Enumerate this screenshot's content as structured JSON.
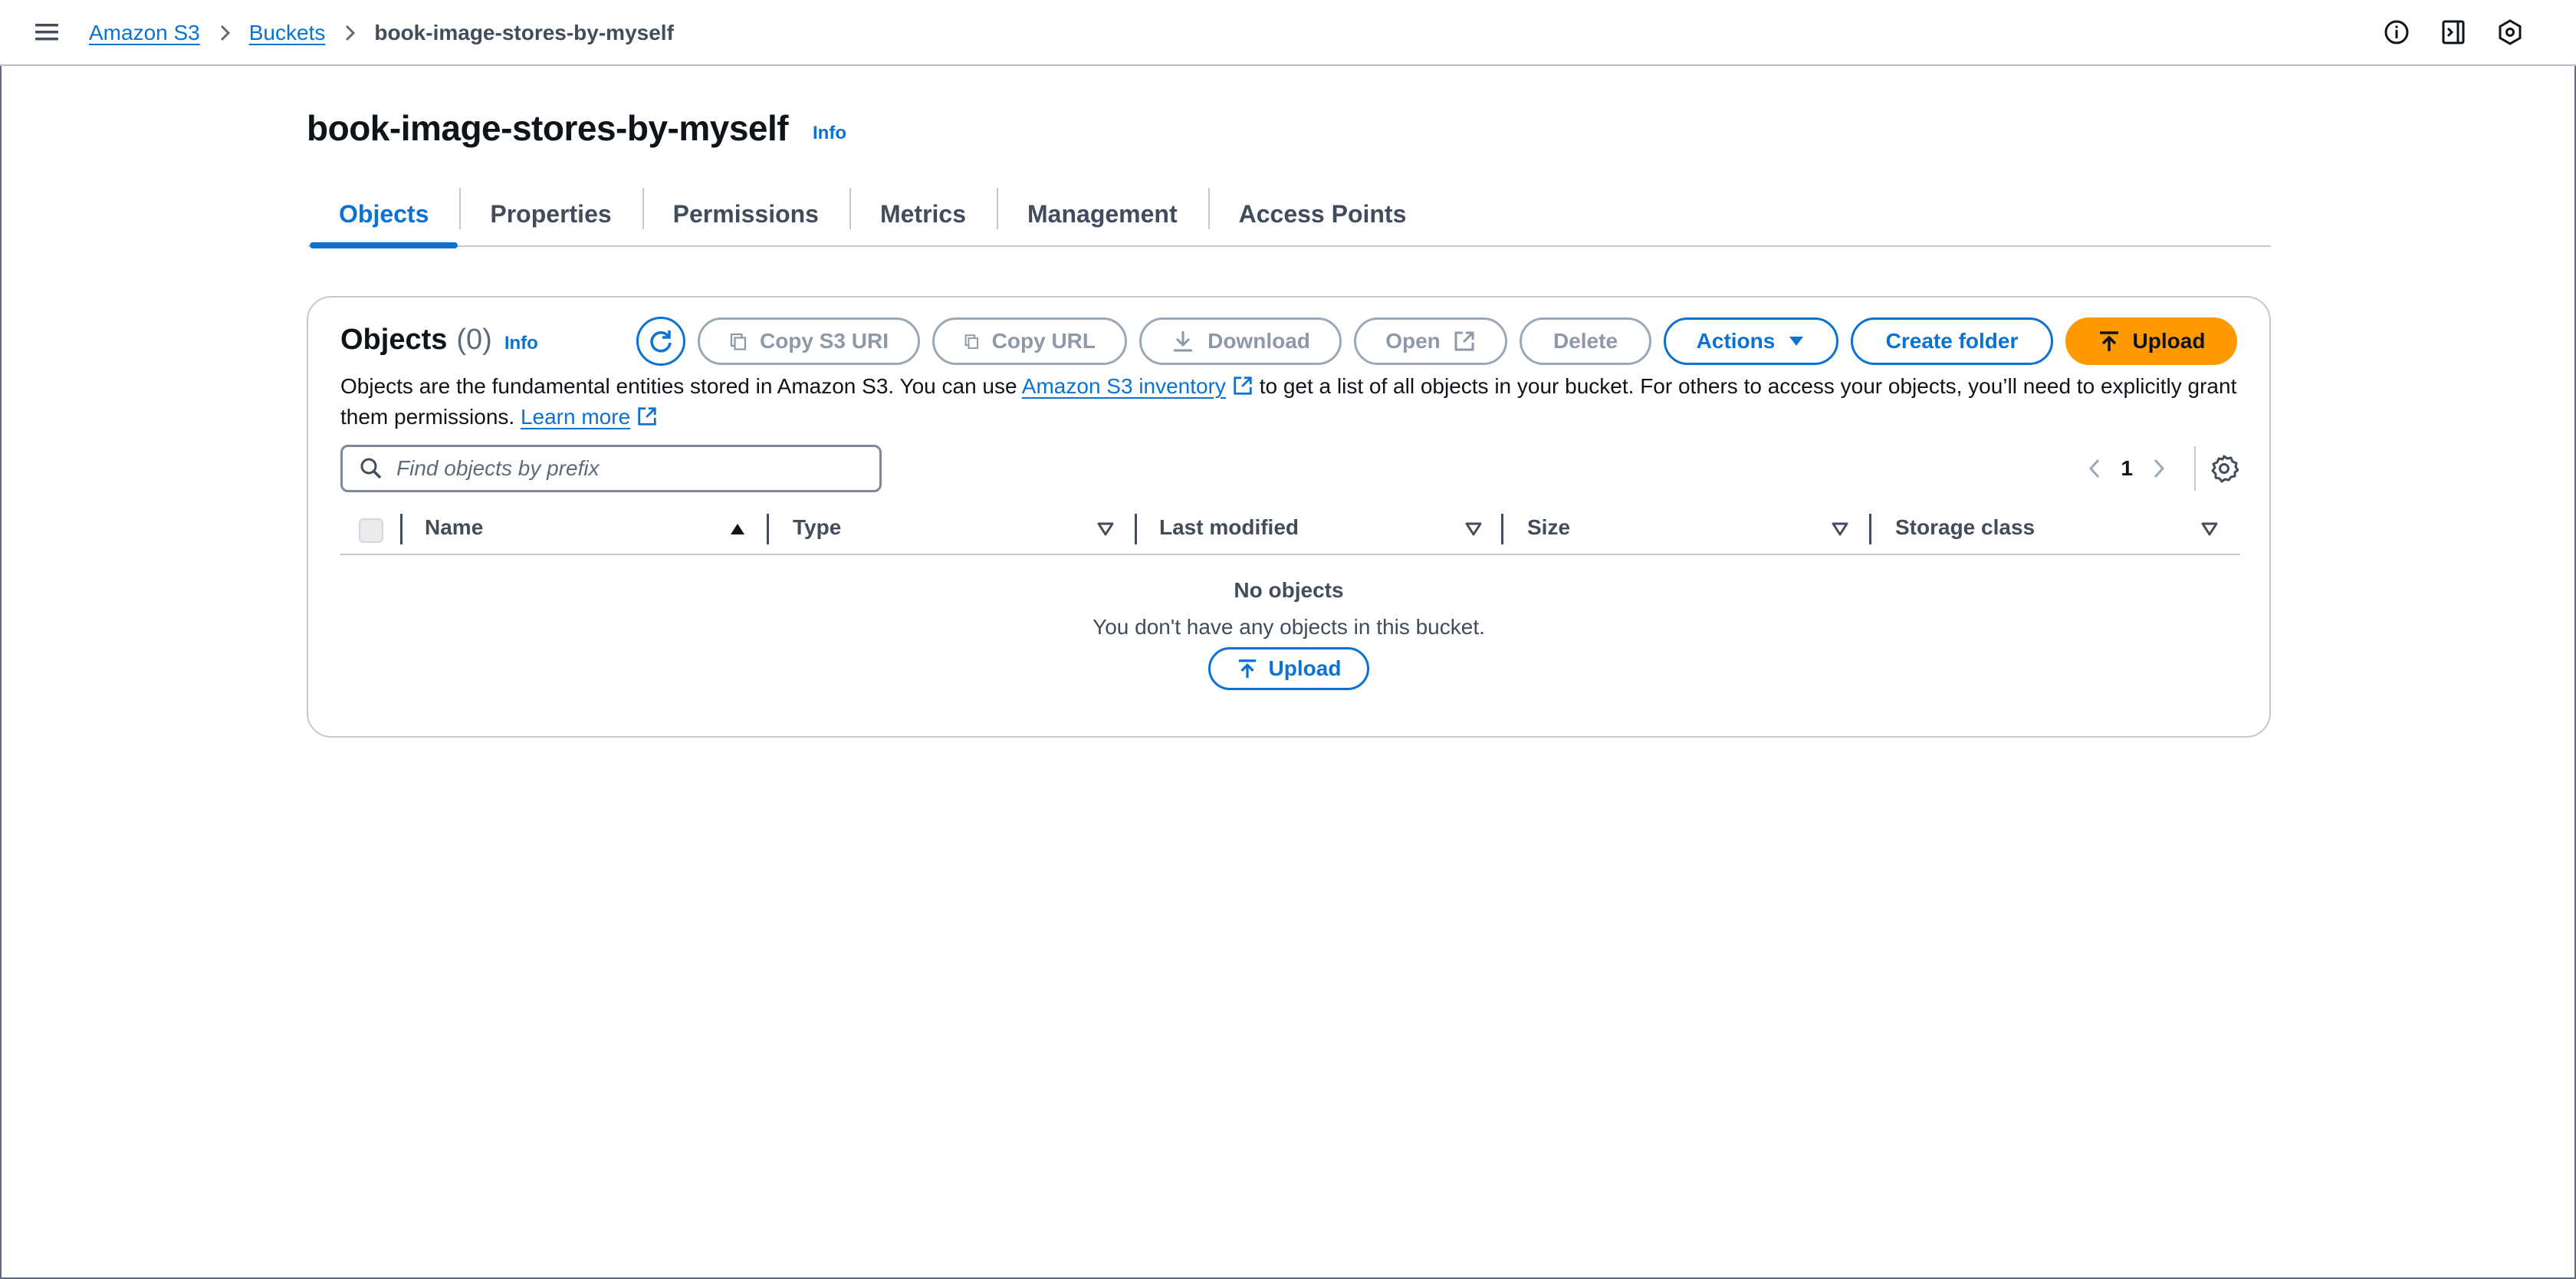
{
  "breadcrumb": {
    "items": [
      {
        "label": "Amazon S3",
        "link": true
      },
      {
        "label": "Buckets",
        "link": true
      },
      {
        "label": "book-image-stores-by-myself",
        "link": false
      }
    ]
  },
  "top_icons": [
    "info-circle-icon",
    "notes-panel-icon",
    "hexagon-settings-icon"
  ],
  "page": {
    "title": "book-image-stores-by-myself",
    "info": "Info"
  },
  "tabs": [
    {
      "label": "Objects",
      "active": true
    },
    {
      "label": "Properties",
      "active": false
    },
    {
      "label": "Permissions",
      "active": false
    },
    {
      "label": "Metrics",
      "active": false
    },
    {
      "label": "Management",
      "active": false
    },
    {
      "label": "Access Points",
      "active": false
    }
  ],
  "objects": {
    "title": "Objects",
    "count": "(0)",
    "info": "Info",
    "toolbar": {
      "copy_s3_uri": "Copy S3 URI",
      "copy_url": "Copy URL",
      "download": "Download",
      "open": "Open",
      "delete": "Delete",
      "actions": "Actions",
      "create_folder": "Create folder",
      "upload": "Upload"
    },
    "description": {
      "part1": "Objects are the fundamental entities stored in Amazon S3. You can use ",
      "inventory_link": "Amazon S3 inventory",
      "part2": " to get a list of all objects in your bucket. For others to access your objects, you’ll need to explicitly grant them permissions. ",
      "learn_more": "Learn more"
    },
    "search": {
      "placeholder": "Find objects by prefix",
      "value": ""
    },
    "pagination": {
      "page": "1"
    },
    "columns": [
      "Name",
      "Type",
      "Last modified",
      "Size",
      "Storage class"
    ],
    "empty": {
      "title": "No objects",
      "text": "You don't have any objects in this bucket.",
      "upload": "Upload"
    }
  },
  "colors": {
    "link_blue": "#0972d3",
    "upload_orange": "#ff9900",
    "disabled_gray": "#8d99a8"
  }
}
